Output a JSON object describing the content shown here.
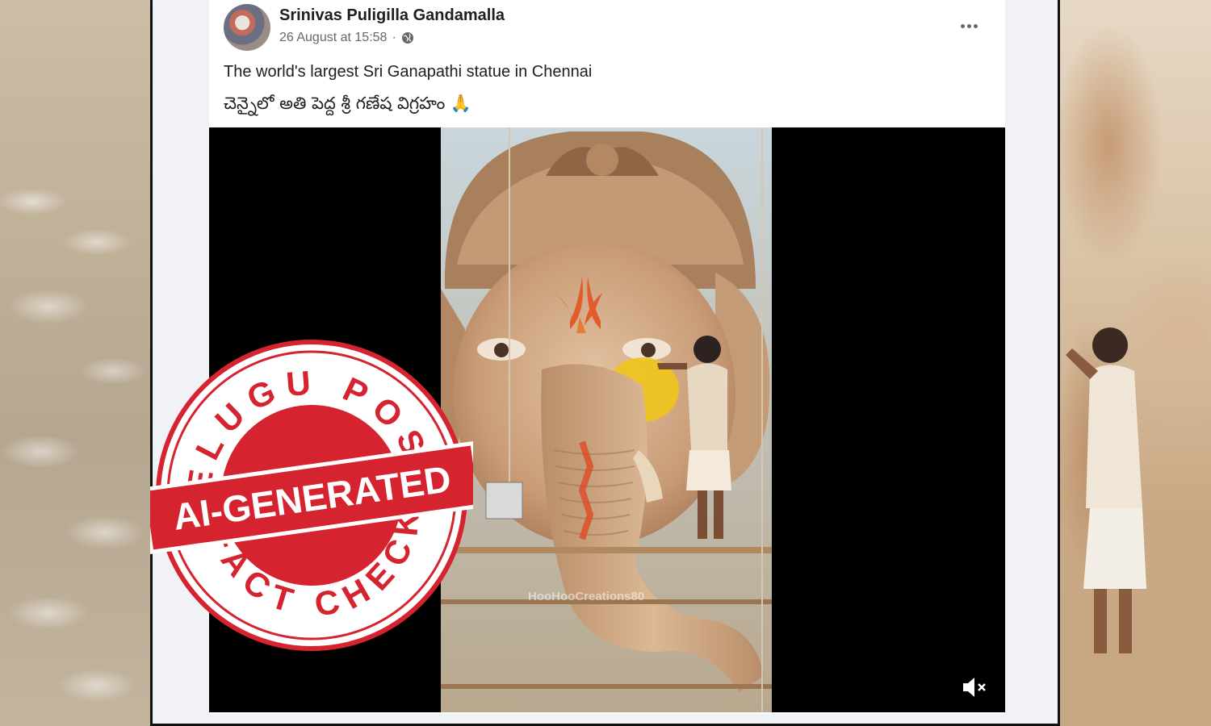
{
  "post": {
    "author": "Srinivas Puligilla Gandamalla",
    "timestamp": "26 August at 15:58",
    "separator": "·",
    "caption_english": "The world's largest Sri Ganapathi statue in Chennai",
    "caption_telugu": "చెన్నైలో అతి పెద్ద శ్రీ గణేష విగ్రహం 🙏",
    "video_watermark": "HooHooCreations80"
  },
  "stamp": {
    "top_text": "TELUGU POST",
    "band_text": "AI-GENERATED",
    "bottom_text": "FACT CHECK",
    "color": "#d5232f"
  },
  "icons": {
    "visibility": "globe-icon",
    "menu": "more-options-icon",
    "audio": "muted-speaker-icon"
  },
  "colors": {
    "name_text": "#1c1e21",
    "meta_text": "#65676b",
    "feed_bg": "#f0f2f5",
    "stamp_red": "#d5232f"
  }
}
